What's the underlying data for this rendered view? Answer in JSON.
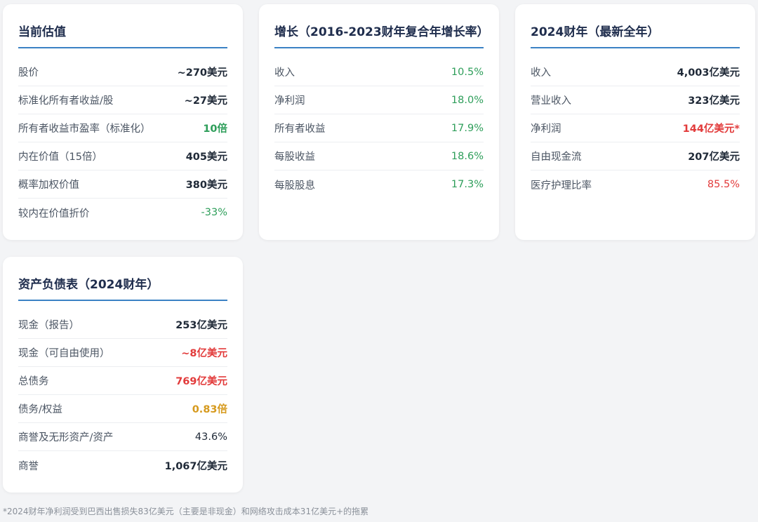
{
  "valuation": {
    "title": "当前估值",
    "rows": [
      {
        "label": "股价",
        "value": "~270美元"
      },
      {
        "label": "标准化所有者收益/股",
        "value": "~27美元"
      },
      {
        "label": "所有者收益市盈率（标准化）",
        "value": "10倍"
      },
      {
        "label": "内在价值（15倍）",
        "value": "405美元"
      },
      {
        "label": "概率加权价值",
        "value": "380美元"
      },
      {
        "label": "较内在价值折价",
        "value": "-33%"
      }
    ]
  },
  "growth": {
    "title": "增长（2016-2023财年复合年增长率）",
    "rows": [
      {
        "label": "收入",
        "value": "10.5%"
      },
      {
        "label": "净利润",
        "value": "18.0%"
      },
      {
        "label": "所有者收益",
        "value": "17.9%"
      },
      {
        "label": "每股收益",
        "value": "18.6%"
      },
      {
        "label": "每股股息",
        "value": "17.3%"
      }
    ]
  },
  "fy2024": {
    "title": "2024财年（最新全年）",
    "rows": [
      {
        "label": "收入",
        "value": "4,003亿美元"
      },
      {
        "label": "营业收入",
        "value": "323亿美元"
      },
      {
        "label": "净利润",
        "value": "144亿美元*"
      },
      {
        "label": "自由现金流",
        "value": "207亿美元"
      },
      {
        "label": "医疗护理比率",
        "value": "85.5%"
      }
    ]
  },
  "balance": {
    "title": "资产负债表（2024财年）",
    "rows": [
      {
        "label": "现金（报告）",
        "value": "253亿美元"
      },
      {
        "label": "现金（可自由使用）",
        "value": "~8亿美元"
      },
      {
        "label": "总债务",
        "value": "769亿美元"
      },
      {
        "label": "债务/权益",
        "value": "0.83倍"
      },
      {
        "label": "商誉及无形资产/资产",
        "value": "43.6%"
      },
      {
        "label": "商誉",
        "value": "1,067亿美元"
      }
    ]
  },
  "colors": {
    "positive": "#2e9e5a",
    "negative": "#e23b3b",
    "warning": "#d69a1e",
    "accent": "#3b82c4",
    "title": "#1f2d4d"
  },
  "footnote": "*2024财年净利润受到巴西出售损失83亿美元（主要是非现金）和网络攻击成本31亿美元+的拖累"
}
